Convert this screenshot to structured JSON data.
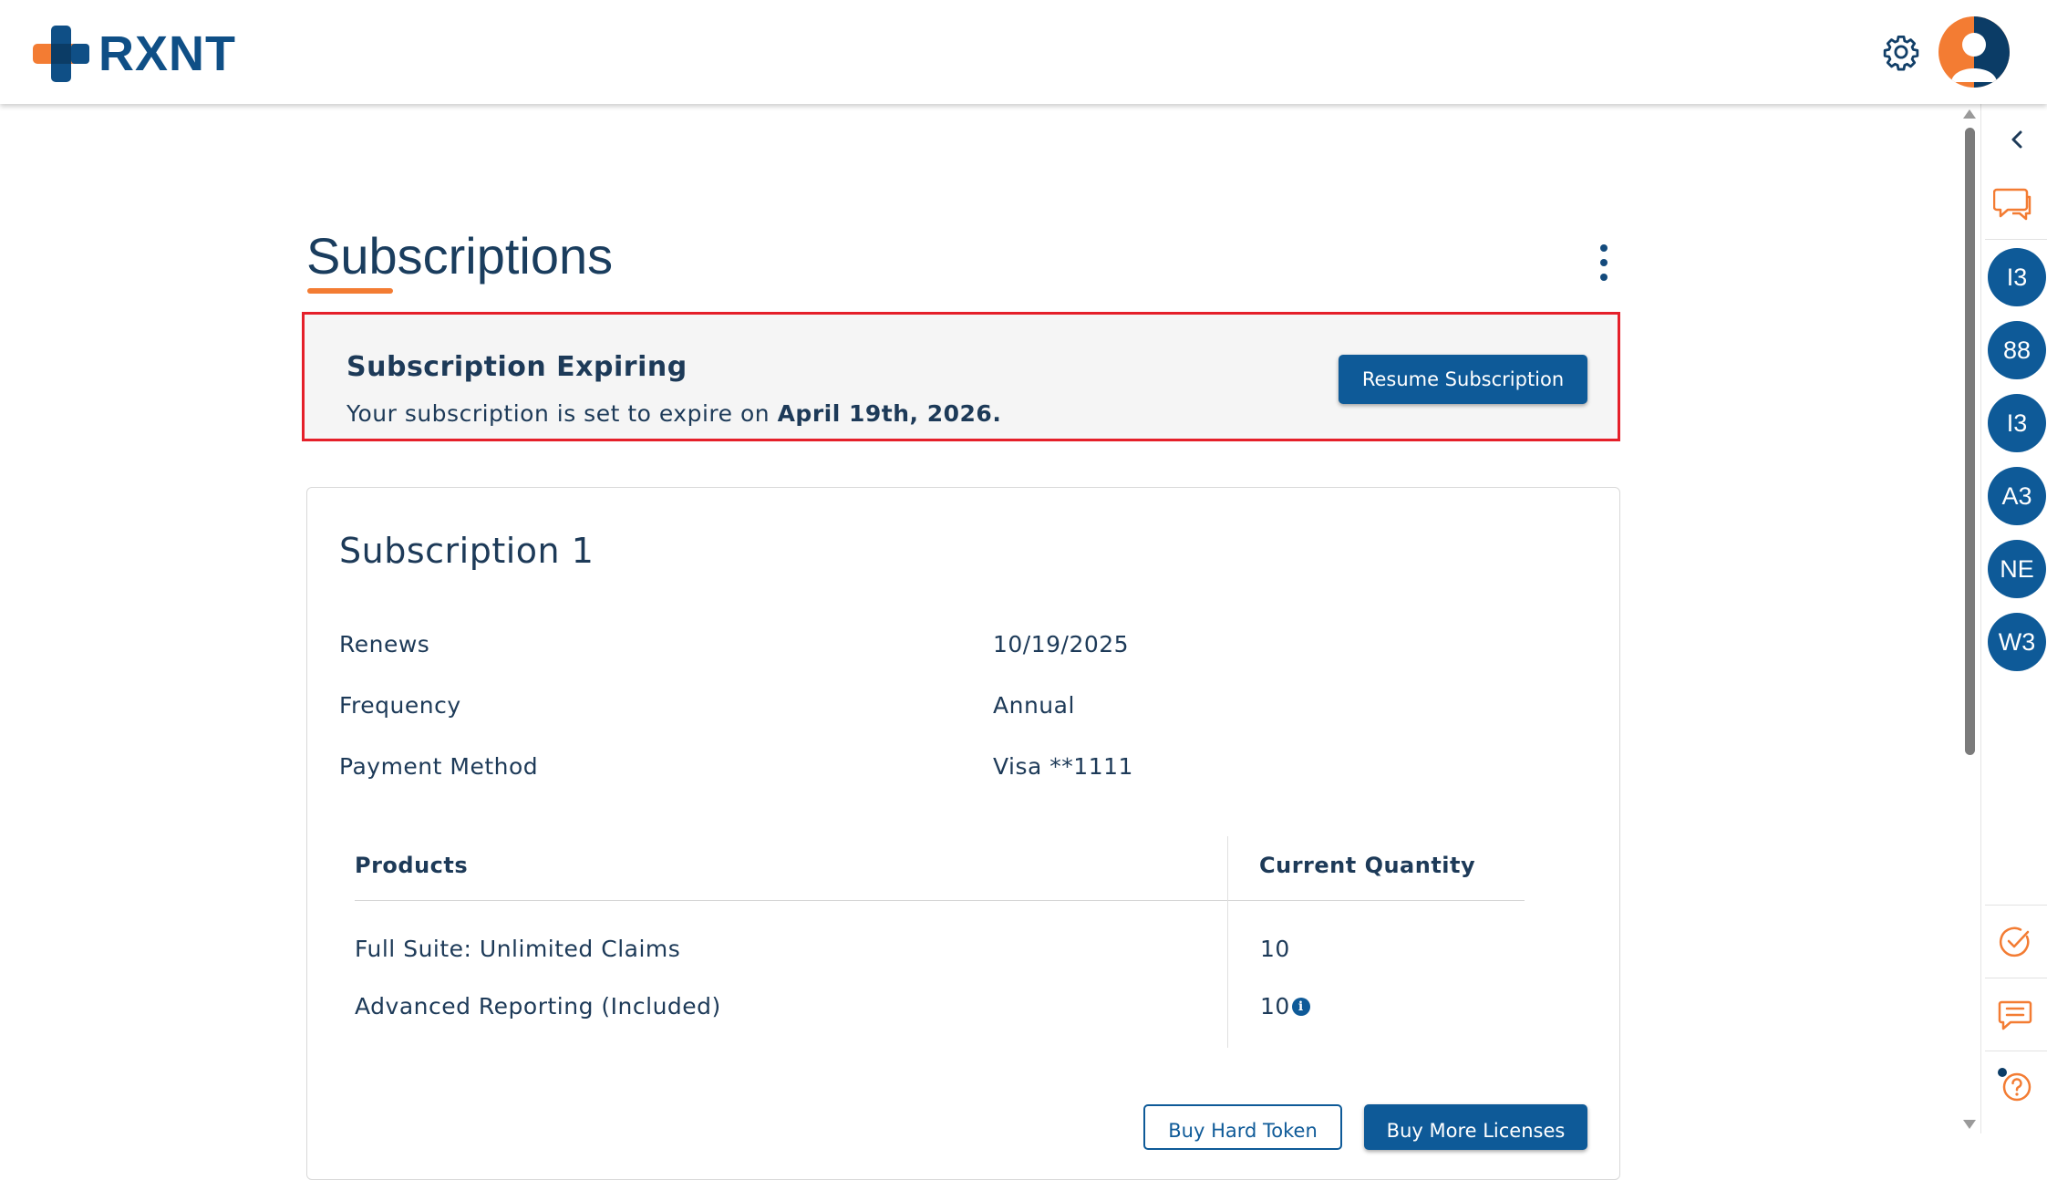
{
  "header": {
    "brand": "RXNT",
    "colors": {
      "brand_blue": "#0f4f86",
      "accent_orange": "#f37c33",
      "primary": "#0e5a98",
      "alert_border": "#e5202a"
    }
  },
  "page": {
    "title": "Subscriptions"
  },
  "alert": {
    "title": "Subscription Expiring",
    "text_prefix": "Your subscription is set to expire on ",
    "date": "April 19th, 2026.",
    "button_label": "Resume Subscription"
  },
  "subscription": {
    "title": "Subscription 1",
    "fields": [
      {
        "label": "Renews",
        "value": "10/19/2025"
      },
      {
        "label": "Frequency",
        "value": "Annual"
      },
      {
        "label": "Payment Method",
        "value": "Visa **1111"
      }
    ],
    "table": {
      "headers": [
        "Products",
        "Current Quantity"
      ],
      "rows": [
        {
          "product": "Full Suite: Unlimited Claims",
          "quantity": "10"
        },
        {
          "product": "Advanced Reporting (Included)",
          "quantity": "10"
        }
      ]
    },
    "buttons": {
      "hard_token": "Buy Hard Token",
      "more_licenses": "Buy More Licenses"
    }
  },
  "rail": {
    "bubbles": [
      "I3",
      "88",
      "I3",
      "A3",
      "NE",
      "W3"
    ],
    "icons": [
      "chevron-left-icon",
      "chat-icon",
      "check-circle-icon",
      "message-icon",
      "help-icon"
    ]
  }
}
